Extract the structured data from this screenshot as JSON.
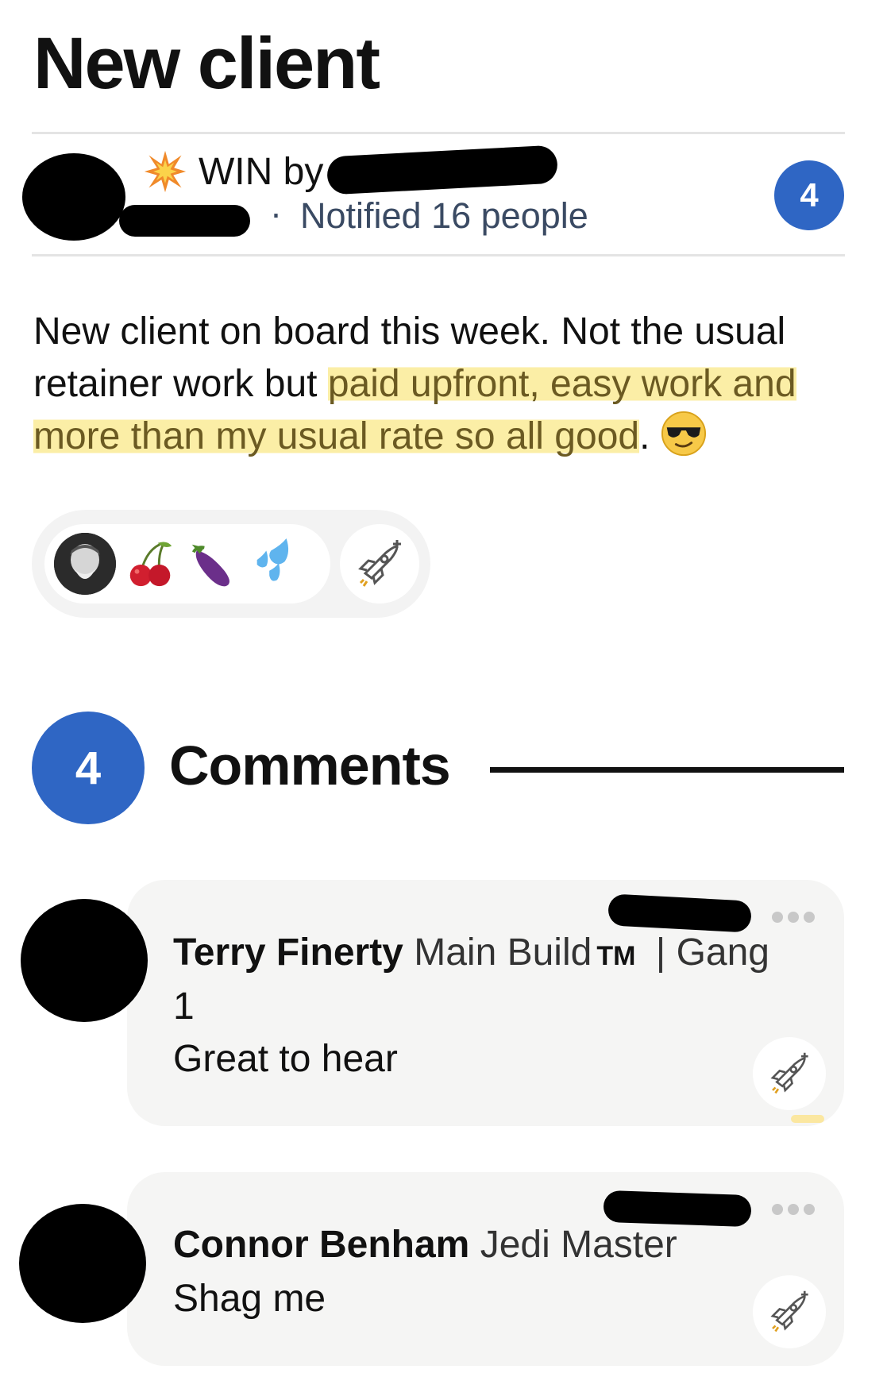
{
  "page": {
    "title": "New client"
  },
  "post": {
    "category": "WIN by",
    "notified": "Notified 16 people",
    "meta_separator": "·",
    "comment_count": "4",
    "body": {
      "plain": "New client on board this week. Not the usual retainer work but ",
      "highlighted": "paid upfront, easy work and more than my usual rate so all good",
      "trailing": "."
    },
    "icons": {
      "category": "explosion-icon",
      "emoji": "sunglasses-emoji"
    }
  },
  "reactions": {
    "items": [
      "cherries-emoji",
      "eggplant-emoji",
      "sweat-droplets-emoji"
    ],
    "add_icon": "rocket-plus-icon"
  },
  "comments_section": {
    "count": "4",
    "title": "Comments"
  },
  "comments": [
    {
      "author": "Terry Finerty",
      "role": "Main Build",
      "tm": "TM",
      "group": "| Gang",
      "group_line2": "1",
      "text": "Great to hear"
    },
    {
      "author": "Connor Benham",
      "role": "Jedi Master",
      "text": "Shag me"
    }
  ],
  "colors": {
    "accent": "#2f66c4",
    "highlight": "#fbeea6",
    "card": "#f5f5f4"
  }
}
